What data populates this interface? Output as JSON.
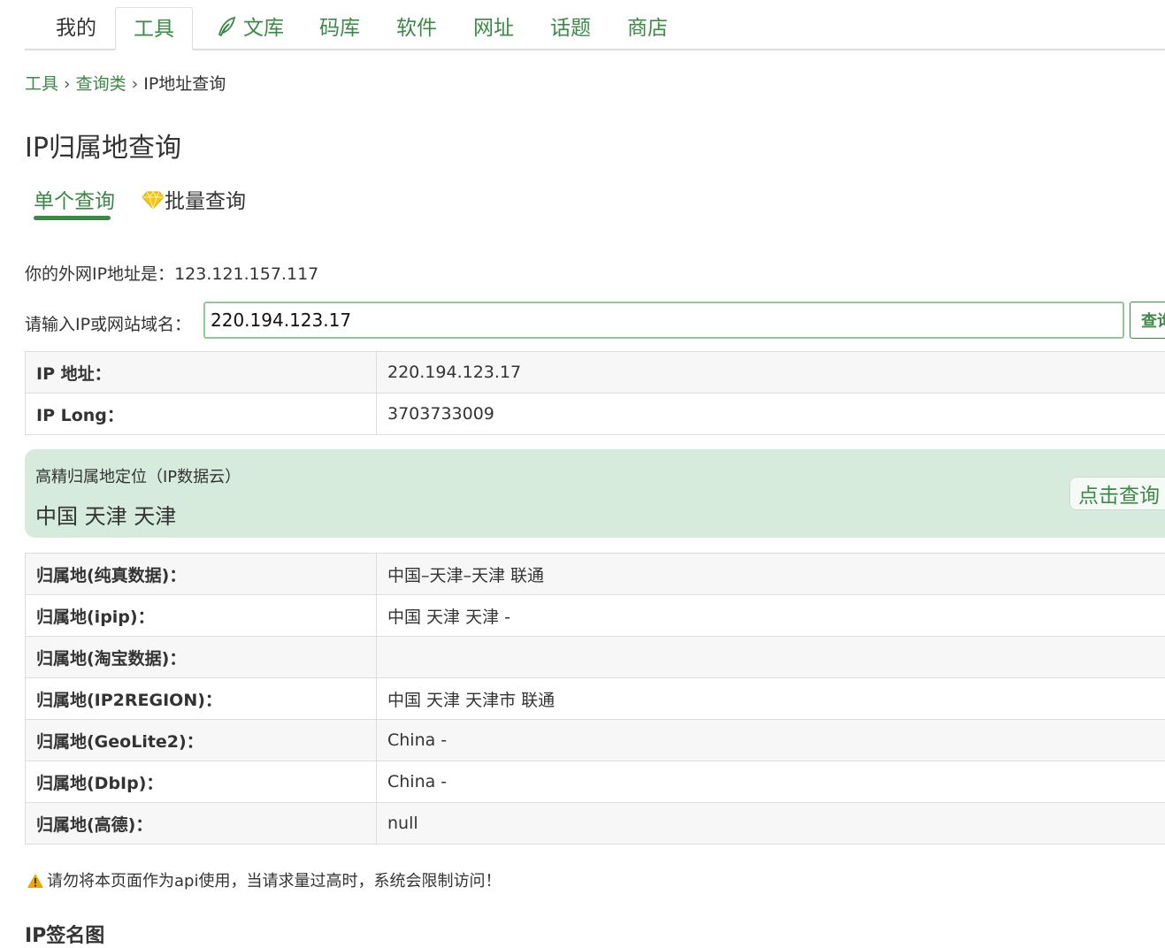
{
  "nav": {
    "items": [
      "我的",
      "工具",
      "文库",
      "码库",
      "软件",
      "网址",
      "话题",
      "商店"
    ]
  },
  "breadcrumb": {
    "root": "工具",
    "category": "查询类",
    "current": "IP地址查询",
    "separator": "›"
  },
  "page_title": "IP归属地查询",
  "tabs": {
    "single": "单个查询",
    "batch": "批量查询"
  },
  "my_ip": {
    "label": "你的外网IP地址是：",
    "value": "123.121.157.117"
  },
  "search": {
    "label": "请输入IP或网站域名：",
    "value": "220.194.123.17",
    "button": "查询"
  },
  "ip_table": [
    {
      "key": "IP 地址：",
      "value": "220.194.123.17"
    },
    {
      "key": "IP Long：",
      "value": "3703733009"
    }
  ],
  "geo": {
    "label": "高精归属地定位（IP数据云）",
    "value": "中国 天津 天津",
    "button": "点击查询"
  },
  "location_table": [
    {
      "key": "归属地(纯真数据)：",
      "value": "中国–天津–天津 联通"
    },
    {
      "key": "归属地(ipip)：",
      "value": "中国 天津 天津 -"
    },
    {
      "key": "归属地(淘宝数据)：",
      "value": ""
    },
    {
      "key": "归属地(IP2REGION)：",
      "value": "中国 天津 天津市 联通"
    },
    {
      "key": "归属地(GeoLite2)：",
      "value": "China -"
    },
    {
      "key": "归属地(DbIp)：",
      "value": "China -"
    },
    {
      "key": "归属地(高德)：",
      "value": "null"
    }
  ],
  "warning": "请勿将本页面作为api使用，当请求量过高时，系统会限制访问！",
  "next_section": "IP签名图",
  "colors": {
    "accent": "#3a8a45",
    "highlight_bg": "#d6ebdc",
    "warning": "#f0a500"
  }
}
